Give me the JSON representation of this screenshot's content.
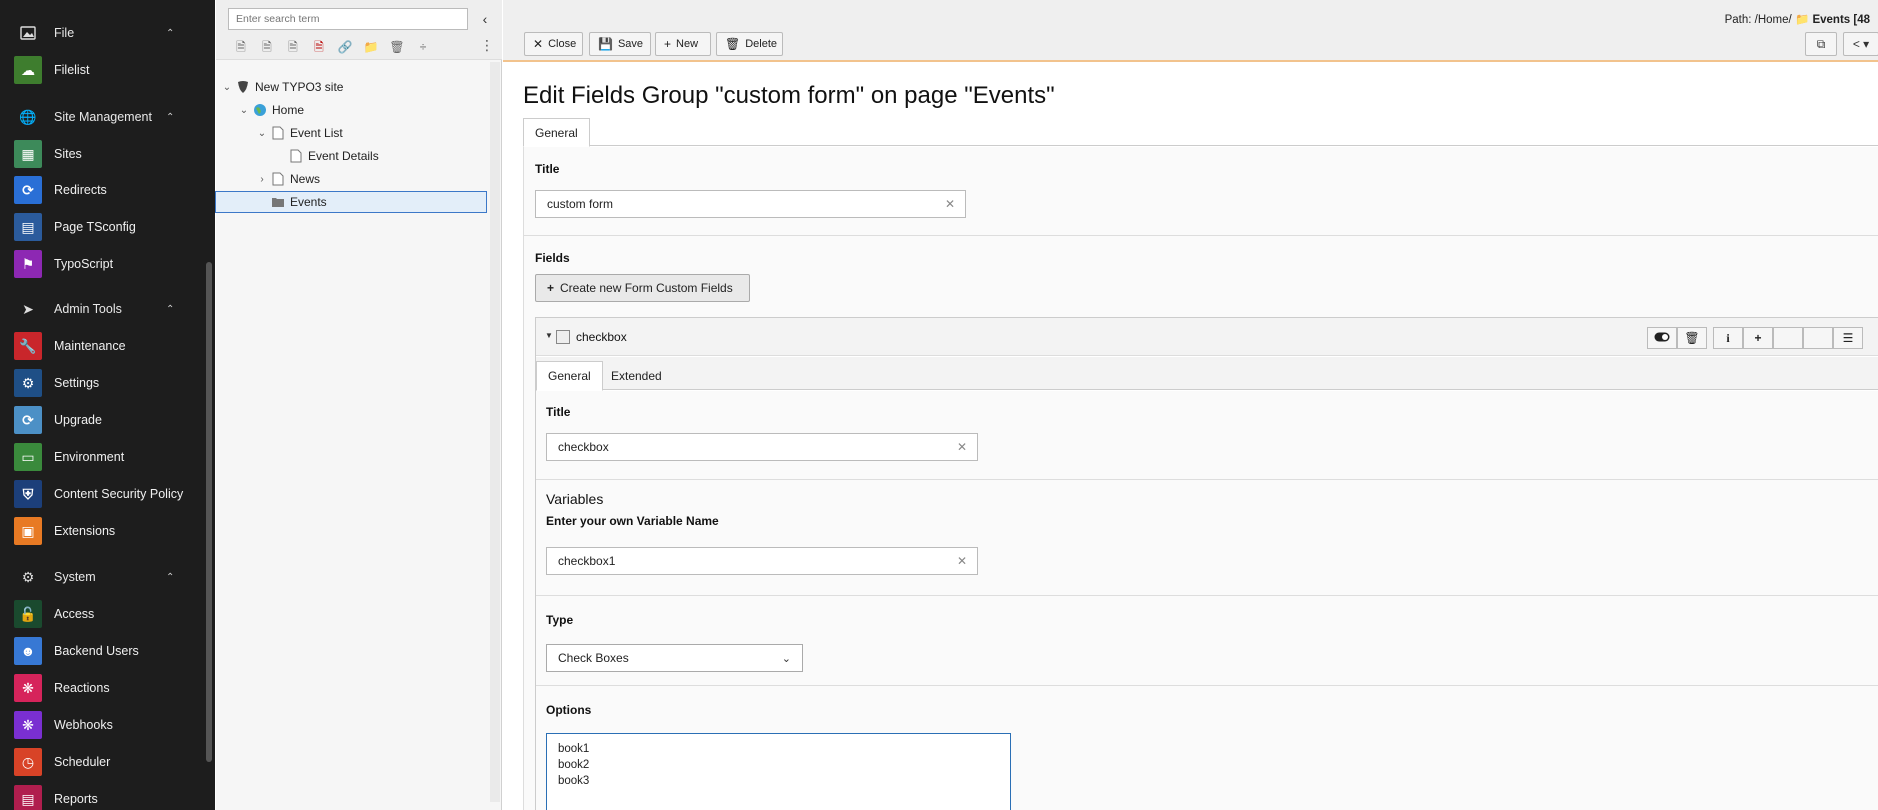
{
  "module_menu": {
    "groups": [
      {
        "label": "File",
        "icon": "file-image-icon"
      },
      {
        "label": "Site Management",
        "icon": "globe-icon"
      },
      {
        "label": "Admin Tools",
        "icon": "rocket-icon"
      },
      {
        "label": "System",
        "icon": "gear-icon"
      }
    ],
    "items": {
      "filelist": "Filelist",
      "sites": "Sites",
      "redirects": "Redirects",
      "page_tsconfig": "Page TSconfig",
      "typoscript": "TypoScript",
      "maintenance": "Maintenance",
      "settings": "Settings",
      "upgrade": "Upgrade",
      "environment": "Environment",
      "csp": "Content Security Policy",
      "extensions": "Extensions",
      "access": "Access",
      "backend_users": "Backend Users",
      "reactions": "Reactions",
      "webhooks": "Webhooks",
      "scheduler": "Scheduler",
      "reports": "Reports"
    },
    "colors": {
      "filelist": "#3e7d2e",
      "sites": "#3d8a5a",
      "redirects": "#2a6fd6",
      "page_tsconfig": "#2b5b9c",
      "typoscript": "#8d28b3",
      "maintenance": "#c9262b",
      "settings": "#1f4f86",
      "upgrade": "#4c90c6",
      "environment": "#3a8a3c",
      "csp": "#1c3f7a",
      "extensions": "#e87a24",
      "access": "#1a4a2e",
      "backend_users": "#3778d4",
      "reactions": "#d6245b",
      "webhooks": "#7a2fd1",
      "scheduler": "#d84327",
      "reports": "#b01e4e"
    }
  },
  "tree": {
    "search_placeholder": "Enter search term",
    "nodes": {
      "root": "New TYPO3 site",
      "home": "Home",
      "event_list": "Event List",
      "event_details": "Event Details",
      "news": "News",
      "events": "Events"
    }
  },
  "docheader": {
    "path_prefix": "Path: /Home/",
    "path_current": "Events [48",
    "buttons": {
      "close": "Close",
      "save": "Save",
      "new": "New",
      "delete": "Delete"
    }
  },
  "page_title": "Edit Fields Group \"custom form\" on page \"Events\"",
  "tabs": {
    "general": "General"
  },
  "form": {
    "title_label": "Title",
    "title_value": "custom form",
    "fields_label": "Fields",
    "create_button": "Create new Form Custom Fields",
    "record": {
      "title": "checkbox",
      "tabs": {
        "general": "General",
        "extended": "Extended"
      },
      "title_label": "Title",
      "title_value": "checkbox",
      "variables_heading": "Variables",
      "varname_label": "Enter your own Variable Name",
      "varname_value": "checkbox1",
      "type_label": "Type",
      "type_value": "Check Boxes",
      "options_label": "Options",
      "options_value": "book1\nbook2\nbook3"
    }
  }
}
